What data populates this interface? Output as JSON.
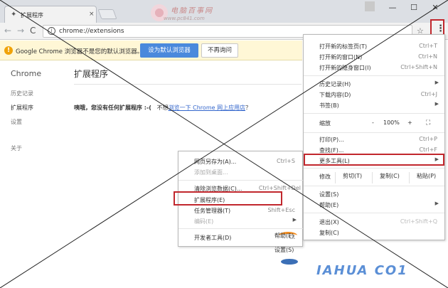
{
  "window": {
    "tab_title": "扩展程序",
    "favicon": "puzzle-icon",
    "tab_close": "×",
    "minimize": "—",
    "maximize": "☐",
    "close": "✕",
    "watermark_line1": "电脑百事网",
    "watermark_line2": "www.pc841.com"
  },
  "toolbar": {
    "back": "←",
    "forward": "→",
    "reload": "C",
    "url": "chrome://extensions",
    "star": "☆",
    "menu": "⋮"
  },
  "infobar": {
    "icon": "!",
    "message": "Google Chrome 浏览器不是您的默认浏览器。",
    "default_button": "设为默认浏览器",
    "never_button": "不再询问"
  },
  "sidebar": {
    "title": "Chrome",
    "items": [
      "历史记录",
      "扩展程序",
      "设置",
      "关于"
    ]
  },
  "main": {
    "title": "扩展程序",
    "empty_bold": "咦哦，您没有任何扩展程序 :-(",
    "empty_prefix": "不想",
    "empty_link": "浏览一下 Chrome 网上应用店",
    "empty_suffix": "？"
  },
  "menu": {
    "new_tab": "打开新的标签页(T)",
    "new_tab_sc": "Ctrl+T",
    "new_window": "打开新的窗口(N)",
    "new_window_sc": "Ctrl+N",
    "incognito": "打开新的隐身窗口(I)",
    "incognito_sc": "Ctrl+Shift+N",
    "history": "历史记录(H)",
    "downloads": "下载内容(D)",
    "downloads_sc": "Ctrl+J",
    "bookmarks": "书签(B)",
    "zoom_label": "缩放",
    "zoom_minus": "-",
    "zoom_value": "100%",
    "zoom_plus": "+",
    "fullscreen": "⛶",
    "print": "打印(P)...",
    "print_sc": "Ctrl+P",
    "find": "查找(F)...",
    "find_sc": "Ctrl+F",
    "more_tools": "更多工具(L)",
    "edit_label": "修改",
    "cut": "剪切(T)",
    "copy": "复制(C)",
    "paste": "粘贴(P)",
    "settings": "设置(S)",
    "help": "帮助(E)",
    "exit": "退出(X)",
    "exit_sc": "Ctrl+Shift+Q",
    "copy_bottom": "复制(C)"
  },
  "submenu": {
    "save_as": "网页另存为(A)...",
    "save_as_sc": "Ctrl+S",
    "add_desktop": "添加到桌面...",
    "clear_data": "清除浏览数据(C)...",
    "clear_data_sc": "Ctrl+Shift+Del",
    "extensions": "扩展程序(E)",
    "task_manager": "任务管理器(T)",
    "task_manager_sc": "Shift+Esc",
    "encoding": "编码(E)",
    "dev_tools": "开发者工具(D)",
    "dev_tools_sc": "Ct"
  },
  "fragments": {
    "help_overlay": "帮助(E)",
    "settings_overlay": "设置(S)",
    "bottom_brand": "IAHUA CO1"
  },
  "colors": {
    "highlight": "#c1272d",
    "primary_button": "#4a89dc",
    "infobar_bg": "#fff7d6"
  }
}
